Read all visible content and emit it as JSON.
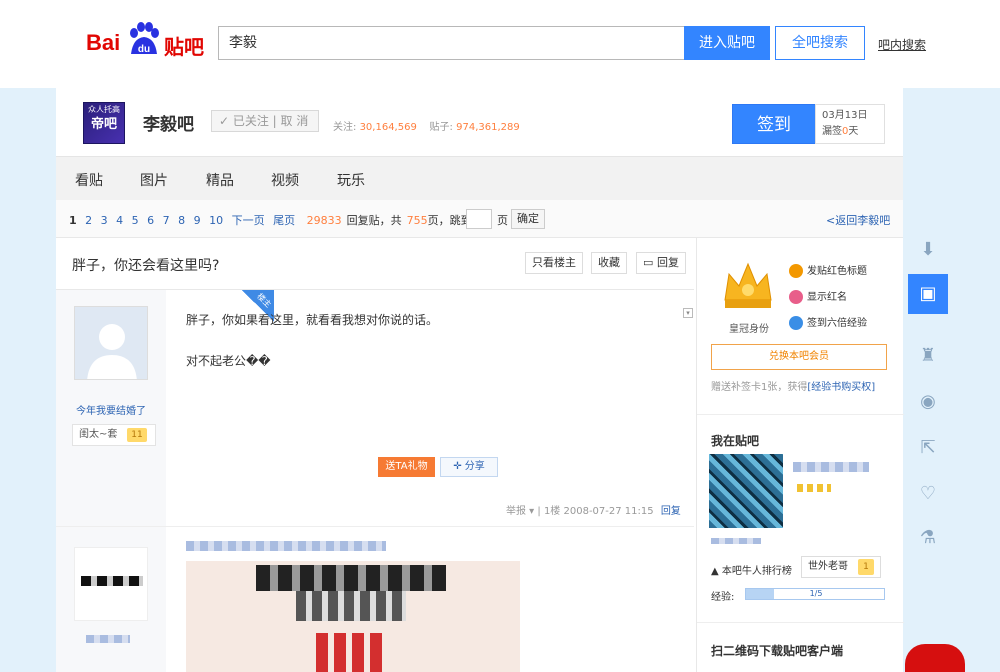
{
  "header": {
    "logo_bai": "Bai",
    "logo_du": "du",
    "logo_tieba": "贴吧",
    "search_value": "李毅",
    "enter_button": "进入贴吧",
    "all_search_button": "全吧搜索",
    "in_bar_search": "吧内搜索"
  },
  "forum": {
    "avatar_line1": "众人托高",
    "avatar_line2": "帝吧",
    "name": "李毅吧",
    "follow_label": "✓ 已关注 | 取 消",
    "followers_label": "关注:",
    "followers": "30,164,569",
    "posts_label": "贴子:",
    "posts": "974,361,289",
    "sign_button": "签到",
    "sign_date": "03月13日",
    "missed_label": "漏签",
    "missed_days": "0",
    "missed_unit": "天"
  },
  "nav": {
    "items": [
      "看贴",
      "图片",
      "精品",
      "视频",
      "玩乐"
    ]
  },
  "pager": {
    "current": "1",
    "pages": [
      "2",
      "3",
      "4",
      "5",
      "6",
      "7",
      "8",
      "9",
      "10"
    ],
    "next": "下一页",
    "last": "尾页",
    "reply_count": "29833",
    "reply_text": "回复贴，共",
    "page_count": "755",
    "page_text": "页，跳到",
    "page_unit": "页",
    "confirm": "确定",
    "back": "<返回李毅吧"
  },
  "thread": {
    "title": "胖子，你还会看这里吗?",
    "only_op": "只看楼主",
    "favorite": "收藏",
    "reply": "回复"
  },
  "post1": {
    "host_tag": "楼主",
    "username": "今年我要结婚了",
    "level_name": "闺太~套",
    "level": "11",
    "text1": "胖子，你如果看这里，就看看我想对你说的话。",
    "text2": "对不起老公��",
    "gift_button": "送TA礼物",
    "share_button": "分享",
    "report": "举报 ▾",
    "floor": "| 1楼",
    "time": "2008-07-27 11:15",
    "reply_link": "回复"
  },
  "sidebar": {
    "crown_label": "皇冠身份",
    "privileges": [
      "发贴红色标题",
      "显示红名",
      "签到六倍经验"
    ],
    "exchange_button": "兑换本吧会员",
    "exchange_note": "赠送补签卡1张，获得",
    "exchange_link": "[经验书购买权]",
    "me_title": "我在贴吧",
    "rank_label": "本吧牛人排行榜",
    "rank_name": "世外老哥",
    "rank_level": "1",
    "exp_label": "经验:",
    "exp_text": "1/5",
    "exp_fraction": 0.2,
    "qr_title": "扫二维码下载贴吧客户端"
  },
  "colors": {
    "brand_blue": "#3385ff",
    "baidu_red": "#e10602",
    "accent_orange": "#ff7f3e",
    "page_bg": "#e2f1fb"
  },
  "rail_icons": [
    "download-icon",
    "message-icon",
    "hat-icon",
    "cat-icon",
    "share-icon",
    "heart-icon",
    "flask-icon"
  ]
}
